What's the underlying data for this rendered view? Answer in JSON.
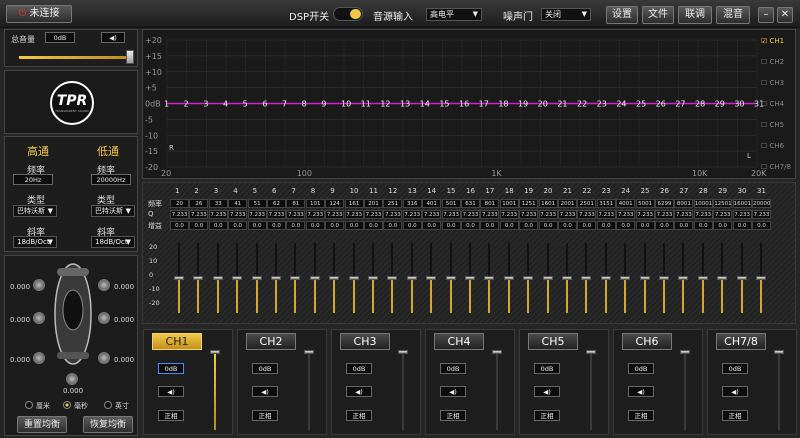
{
  "topbar": {
    "connect_label": "未连接",
    "dsp_label": "DSP开关",
    "source_label": "音源输入",
    "source_value": "高电平",
    "noise_gate_label": "噪声门",
    "noise_gate_value": "关闭",
    "menu": [
      "设置",
      "文件",
      "联调",
      "混音"
    ]
  },
  "volume": {
    "label": "总音量",
    "value": "0dB",
    "speaker_icon": "speaker-icon"
  },
  "logo": {
    "text": "TPR",
    "subtext": "TRANSPARENT SOUND"
  },
  "xover": {
    "high_title": "高通",
    "low_title": "低通",
    "freq_label": "频率",
    "type_label": "类型",
    "slope_label": "斜率",
    "high_freq": "20Hz",
    "low_freq": "20000Hz",
    "high_type": "巴特沃斯",
    "low_type": "巴特沃斯",
    "high_slope": "18dB/Oct",
    "low_slope": "18dB/Oct"
  },
  "car": {
    "values": [
      "0.000",
      "0.000",
      "0.000",
      "0.000",
      "0.000",
      "0.000",
      "0.000"
    ],
    "units": [
      "厘米",
      "毫秒",
      "英寸"
    ],
    "reset_label": "重置均衡",
    "restore_label": "恢复均衡"
  },
  "graph": {
    "y_ticks": [
      "+20",
      "+15",
      "+10",
      "+5",
      "0dB",
      "-5",
      "-10",
      "-15",
      "-20"
    ],
    "x_ticks": [
      "20",
      "100",
      "1K",
      "10K",
      "20K"
    ],
    "marker_l": "L",
    "marker_r": "R",
    "points": [
      "1",
      "2",
      "3",
      "4",
      "5",
      "6",
      "7",
      "8",
      "9",
      "10",
      "11",
      "12",
      "13",
      "14",
      "15",
      "16",
      "17",
      "18",
      "19",
      "20",
      "21",
      "22",
      "23",
      "24",
      "25",
      "26",
      "27",
      "28",
      "29",
      "30",
      "31"
    ],
    "line_color": "#d020d0"
  },
  "channels_legend": [
    "CH1",
    "CH2",
    "CH3",
    "CH4",
    "CH5",
    "CH6",
    "CH7/8"
  ],
  "eq": {
    "row_labels": [
      "频率",
      "Q",
      "增益"
    ],
    "gain_scale": [
      "20",
      "10",
      "0",
      "-10",
      "-20"
    ],
    "bands": [
      "1",
      "2",
      "3",
      "4",
      "5",
      "6",
      "7",
      "8",
      "9",
      "10",
      "11",
      "12",
      "13",
      "14",
      "15",
      "16",
      "17",
      "18",
      "19",
      "20",
      "21",
      "22",
      "23",
      "24",
      "25",
      "26",
      "27",
      "28",
      "29",
      "30",
      "31"
    ],
    "freqs": [
      "20",
      "26",
      "33",
      "41",
      "51",
      "62",
      "81",
      "101",
      "124",
      "161",
      "201",
      "251",
      "316",
      "401",
      "501",
      "631",
      "801",
      "1001",
      "1251",
      "1601",
      "2001",
      "2501",
      "3151",
      "4001",
      "5001",
      "6299",
      "8001",
      "10001",
      "12501",
      "16001",
      "20000"
    ],
    "q": "7.233",
    "gain": "0.0"
  },
  "channel_strips": [
    {
      "name": "CH1",
      "active": true,
      "db": "0dB",
      "phase": "正相"
    },
    {
      "name": "CH2",
      "active": false,
      "db": "0dB",
      "phase": "正相"
    },
    {
      "name": "CH3",
      "active": false,
      "db": "0dB",
      "phase": "正相"
    },
    {
      "name": "CH4",
      "active": false,
      "db": "0dB",
      "phase": "正相"
    },
    {
      "name": "CH5",
      "active": false,
      "db": "0dB",
      "phase": "正相"
    },
    {
      "name": "CH6",
      "active": false,
      "db": "0dB",
      "phase": "正相"
    },
    {
      "name": "CH7/8",
      "active": false,
      "db": "0dB",
      "phase": "正相"
    }
  ],
  "colors": {
    "accent": "#f2c84b",
    "curve": "#d020d0",
    "background": "#262626"
  }
}
